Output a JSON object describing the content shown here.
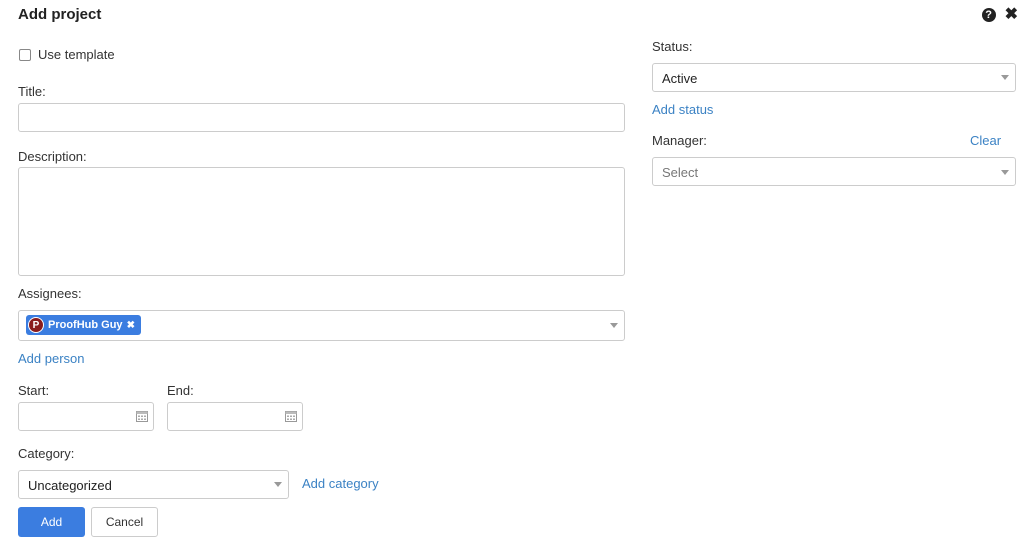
{
  "header": {
    "title": "Add project",
    "help_icon": "help-icon",
    "close_icon": "close-icon",
    "help_glyph": "?",
    "close_glyph": "✖"
  },
  "template": {
    "label": "Use template",
    "checked": false
  },
  "title_field": {
    "label": "Title:",
    "value": ""
  },
  "description_field": {
    "label": "Description:",
    "value": ""
  },
  "assignees": {
    "label": "Assignees:",
    "tags": [
      {
        "initial": "P",
        "name": "ProofHub Guy"
      }
    ],
    "add_link": "Add person"
  },
  "start": {
    "label": "Start:",
    "value": ""
  },
  "end": {
    "label": "End:",
    "value": ""
  },
  "category": {
    "label": "Category:",
    "value": "Uncategorized",
    "add_link": "Add category"
  },
  "buttons": {
    "add": "Add",
    "cancel": "Cancel"
  },
  "status": {
    "label": "Status:",
    "value": "Active",
    "add_link": "Add status"
  },
  "manager": {
    "label": "Manager:",
    "clear_link": "Clear",
    "placeholder": "Select"
  },
  "colors": {
    "accent": "#3b7de0",
    "link": "#3b82c4",
    "avatar": "#8a1c1c"
  }
}
